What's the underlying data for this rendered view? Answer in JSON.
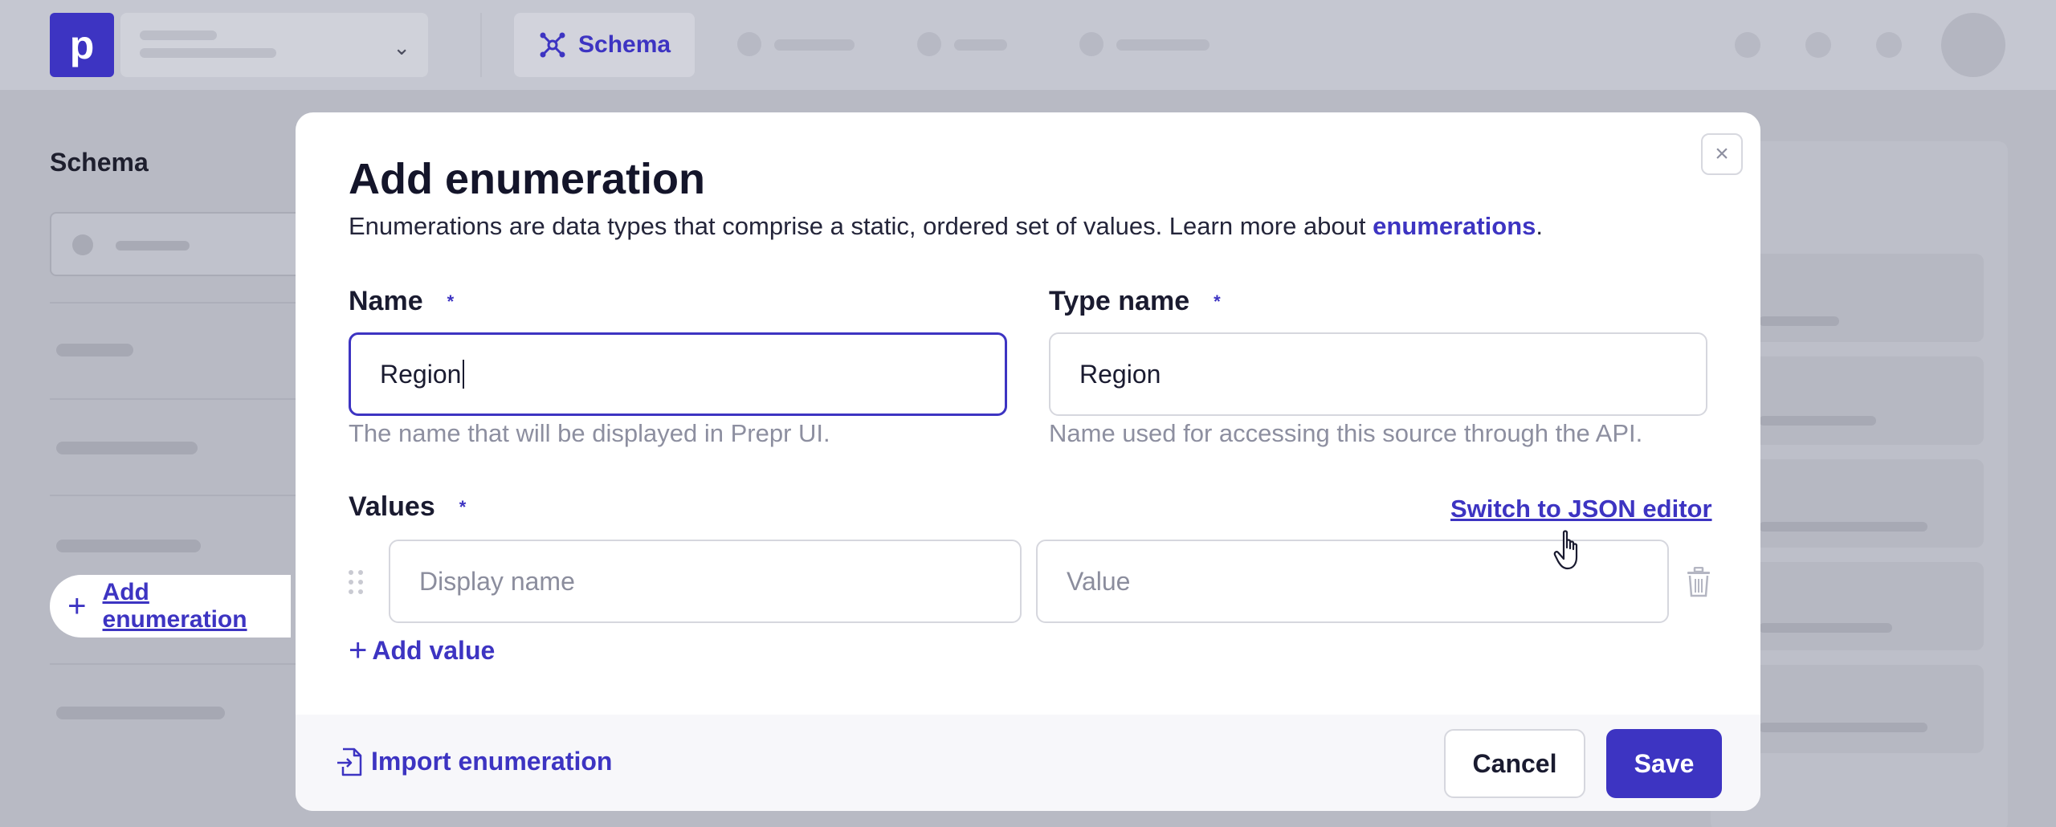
{
  "app": {
    "logo_letter": "p",
    "nav": {
      "schema_label": "Schema"
    }
  },
  "sidebar": {
    "title": "Schema",
    "add_enumeration_label": "Add enumeration"
  },
  "modal": {
    "title": "Add enumeration",
    "description_text": "Enumerations are data types that comprise a static, ordered set of values. Learn more about ",
    "description_link": "enumerations",
    "description_end": ".",
    "name": {
      "label": "Name",
      "required_mark": "*",
      "value": "Region",
      "help": "The name that will be displayed in Prepr UI."
    },
    "type_name": {
      "label": "Type name",
      "required_mark": "*",
      "value": "Region",
      "help": "Name used for accessing this source through the API."
    },
    "values": {
      "label": "Values",
      "required_mark": "*",
      "switch_link": "Switch to JSON editor",
      "display_name_placeholder": "Display name",
      "value_placeholder": "Value",
      "add_value_label": "Add value"
    },
    "footer": {
      "import_label": "Import enumeration",
      "cancel_label": "Cancel",
      "save_label": "Save"
    }
  },
  "colors": {
    "accent": "#3d34c2",
    "overlay": "#b8bac4",
    "text_muted": "#8d8fa0"
  },
  "icons": [
    "schema-icon",
    "chevron-down-icon",
    "plus-icon",
    "close-icon",
    "drag-handle-icon",
    "trash-icon",
    "import-file-icon",
    "pointer-cursor-icon"
  ]
}
